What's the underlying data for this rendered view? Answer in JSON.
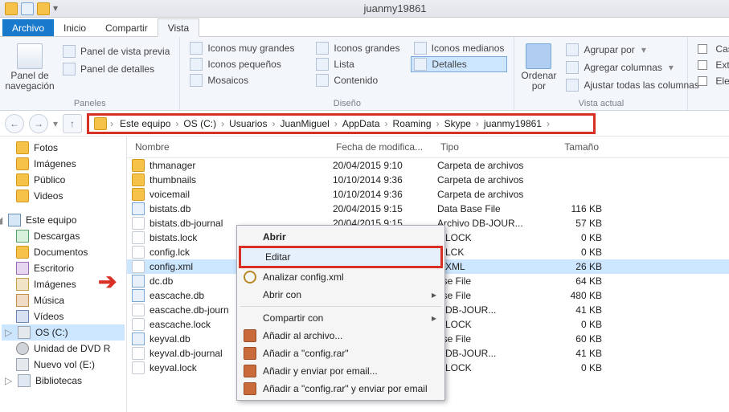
{
  "window": {
    "title": "juanmy19861"
  },
  "tabs": {
    "file": "Archivo",
    "home": "Inicio",
    "share": "Compartir",
    "view": "Vista"
  },
  "ribbon": {
    "nav": {
      "big": "Panel de\nnavegación",
      "preview": "Panel de vista previa",
      "details": "Panel de detalles",
      "group": "Paneles"
    },
    "layout": {
      "xl": "Iconos muy grandes",
      "lg": "Iconos grandes",
      "md": "Iconos medianos",
      "sm": "Iconos pequeños",
      "list": "Lista",
      "det": "Detalles",
      "tiles": "Mosaicos",
      "content": "Contenido",
      "group": "Diseño"
    },
    "sort": {
      "big": "Ordenar\npor",
      "groupby": "Agrupar por",
      "addcols": "Agregar columnas",
      "fitcols": "Ajustar todas las columnas",
      "group": "Vista actual"
    },
    "showhide": {
      "c1": "Casil",
      "c2": "Exter",
      "c3": "Elem"
    }
  },
  "breadcrumb": [
    "Este equipo",
    "OS (C:)",
    "Usuarios",
    "JuanMiguel",
    "AppData",
    "Roaming",
    "Skype",
    "juanmy19861"
  ],
  "tree": {
    "top": [
      "Fotos",
      "Imágenes",
      "Público",
      "Videos"
    ],
    "pc": "Este equipo",
    "pcItems": [
      "Descargas",
      "Documentos",
      "Escritorio",
      "Imágenes",
      "Música",
      "Vídeos",
      "OS (C:)",
      "Unidad de DVD R",
      "Nuevo vol (E:)",
      "Bibliotecas"
    ]
  },
  "cols": {
    "name": "Nombre",
    "date": "Fecha de modifica...",
    "type": "Tipo",
    "size": "Tamaño"
  },
  "files": [
    {
      "n": "thmanager",
      "d": "20/04/2015 9:10",
      "t": "Carpeta de archivos",
      "s": "",
      "ic": "ic-yfolder"
    },
    {
      "n": "thumbnails",
      "d": "10/10/2014 9:36",
      "t": "Carpeta de archivos",
      "s": "",
      "ic": "ic-yfolder"
    },
    {
      "n": "voicemail",
      "d": "10/10/2014 9:36",
      "t": "Carpeta de archivos",
      "s": "",
      "ic": "ic-yfolder"
    },
    {
      "n": "bistats.db",
      "d": "20/04/2015 9:15",
      "t": "Data Base File",
      "s": "116 KB",
      "ic": "ic-db"
    },
    {
      "n": "bistats.db-journal",
      "d": "20/04/2015 9:15",
      "t": "Archivo DB-JOUR...",
      "s": "57 KB",
      "ic": "ic-file"
    },
    {
      "n": "bistats.lock",
      "d": "",
      "t": "o LOCK",
      "s": "0 KB",
      "ic": "ic-file"
    },
    {
      "n": "config.lck",
      "d": "",
      "t": "o LCK",
      "s": "0 KB",
      "ic": "ic-file"
    },
    {
      "n": "config.xml",
      "d": "",
      "t": "o XML",
      "s": "26 KB",
      "ic": "ic-file",
      "sel": true
    },
    {
      "n": "dc.db",
      "d": "",
      "t": "ase File",
      "s": "64 KB",
      "ic": "ic-db"
    },
    {
      "n": "eascache.db",
      "d": "",
      "t": "ase File",
      "s": "480 KB",
      "ic": "ic-db"
    },
    {
      "n": "eascache.db-journ",
      "d": "",
      "t": "o DB-JOUR...",
      "s": "41 KB",
      "ic": "ic-file"
    },
    {
      "n": "eascache.lock",
      "d": "",
      "t": "o LOCK",
      "s": "0 KB",
      "ic": "ic-file"
    },
    {
      "n": "keyval.db",
      "d": "",
      "t": "ase File",
      "s": "60 KB",
      "ic": "ic-db"
    },
    {
      "n": "keyval.db-journal",
      "d": "",
      "t": "o DB-JOUR...",
      "s": "41 KB",
      "ic": "ic-file"
    },
    {
      "n": "keyval.lock",
      "d": "",
      "t": "o LOCK",
      "s": "0 KB",
      "ic": "ic-file"
    }
  ],
  "ctx": {
    "open": "Abrir",
    "edit": "Editar",
    "scan": "Analizar config.xml",
    "openwith": "Abrir con",
    "sharewith": "Compartir con",
    "addarchive": "Añadir al archivo...",
    "addrar": "Añadir a \"config.rar\"",
    "sendemail": "Añadir y enviar por email...",
    "sendraremail": "Añadir a \"config.rar\" y enviar por email"
  }
}
